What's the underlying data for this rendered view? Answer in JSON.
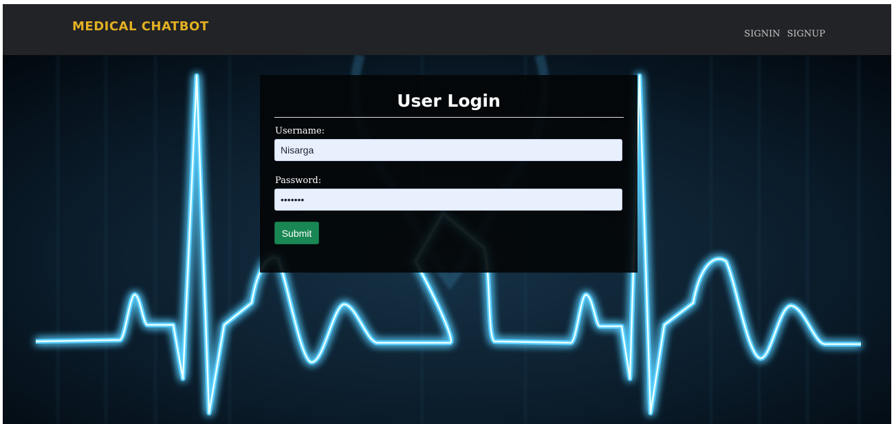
{
  "navbar": {
    "brand": "MEDICAL CHATBOT",
    "links": [
      {
        "label": "SIGNIN"
      },
      {
        "label": "SIGNUP"
      }
    ]
  },
  "login_form": {
    "title": "User Login",
    "username": {
      "label": "Username:",
      "value": "Nisarga"
    },
    "password": {
      "label": "Password:",
      "value": "•••••••"
    },
    "submit_label": "Submit"
  },
  "colors": {
    "brand": "#e3b022",
    "navbar_bg": "#222326",
    "panel_bg": "#030507",
    "input_bg": "#e8f0fe",
    "submit_bg": "#198754",
    "heartbeat_glow": "#5fd4ff"
  },
  "background": {
    "icon": "heartbeat-ecg-image"
  }
}
